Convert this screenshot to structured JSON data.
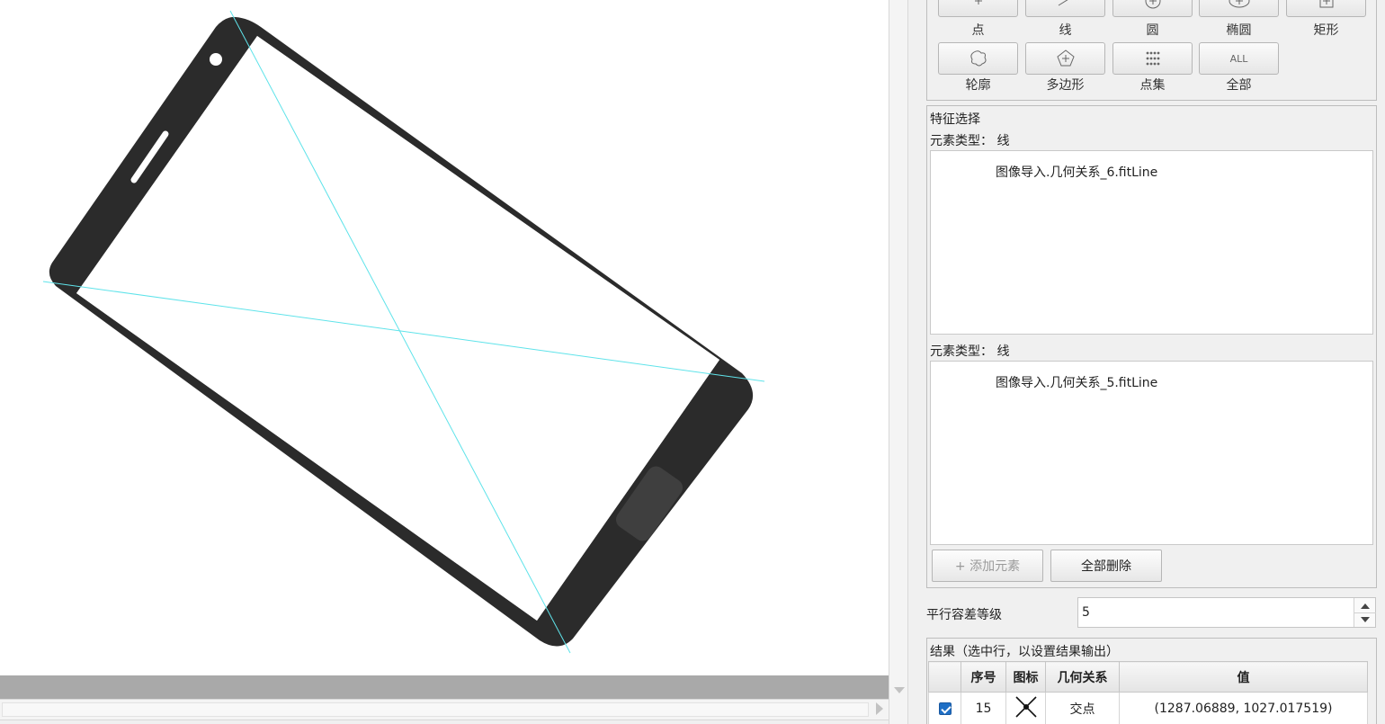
{
  "shape_buttons": [
    {
      "label": "点",
      "icon": "point-icon"
    },
    {
      "label": "线",
      "icon": "line-icon"
    },
    {
      "label": "圆",
      "icon": "circle-icon"
    },
    {
      "label": "椭圆",
      "icon": "ellipse-icon"
    },
    {
      "label": "矩形",
      "icon": "rectangle-icon"
    },
    {
      "label": "轮廓",
      "icon": "contour-icon"
    },
    {
      "label": "多边形",
      "icon": "polygon-icon"
    },
    {
      "label": "点集",
      "icon": "point-set-icon"
    },
    {
      "label": "全部",
      "icon": "all-icon",
      "icon_text": "ALL"
    }
  ],
  "feature_select": {
    "title": "特征选择",
    "element1": {
      "type_label": "元素类型： 线",
      "items": [
        "图像导入.几何关系_6.fitLine"
      ]
    },
    "element2": {
      "type_label": "元素类型： 线",
      "items": [
        "图像导入.几何关系_5.fitLine"
      ]
    },
    "add_button": "+ 添加元素",
    "delete_all_button": "全部删除"
  },
  "tolerance": {
    "label": "平行容差等级",
    "value": "5"
  },
  "results": {
    "title": "结果（选中行，以设置结果输出）",
    "columns": [
      "",
      "序号",
      "图标",
      "几何关系",
      "值"
    ],
    "rows": [
      {
        "checked": true,
        "index": "15",
        "icon": "intersection-icon",
        "relation": "交点",
        "value": "(1287.06889, 1027.017519)"
      }
    ]
  },
  "colors": {
    "fitted_line": "#5fe3ea",
    "phone_frame": "#2b2b2b",
    "checkbox": "#1f6fc5"
  }
}
